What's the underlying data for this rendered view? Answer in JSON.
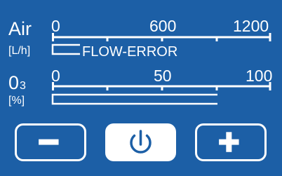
{
  "air": {
    "label": "Air",
    "unit": "[L/h]",
    "ticks": [
      "0",
      "600",
      "1200"
    ],
    "scale_max": 1200,
    "status": "FLOW-ERROR"
  },
  "ozone": {
    "label_main": "0",
    "label_sub": "3",
    "unit": "[%]",
    "ticks": [
      "0",
      "50",
      "100"
    ],
    "scale_max": 100
  },
  "controls": {
    "minus_icon": "minus-icon",
    "power_icon": "power-icon",
    "plus_icon": "plus-icon"
  },
  "colors": {
    "background": "#1c5fa6",
    "foreground": "#ffffff"
  }
}
